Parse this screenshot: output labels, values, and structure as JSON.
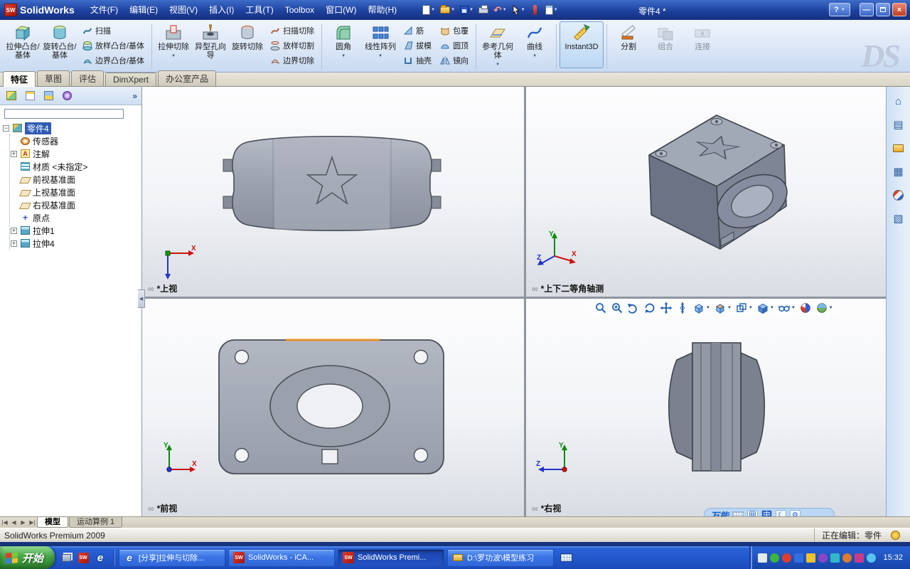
{
  "window": {
    "app_name": "SolidWorks",
    "doc_title": "零件4 *",
    "help_label": "?"
  },
  "menubar": {
    "items": [
      {
        "label": "文件(F)"
      },
      {
        "label": "编辑(E)"
      },
      {
        "label": "视图(V)"
      },
      {
        "label": "插入(I)"
      },
      {
        "label": "工具(T)"
      },
      {
        "label": "Toolbox"
      },
      {
        "label": "窗口(W)"
      },
      {
        "label": "帮助(H)"
      }
    ]
  },
  "ribbon": {
    "watermark": "DS",
    "buttons": {
      "extrude_boss": "拉伸凸台/基体",
      "revolve_boss": "旋转凸台/基体",
      "sweep": "扫描",
      "loft_boss": "放样凸台/基体",
      "boundary_boss": "边界凸台/基体",
      "extrude_cut": "拉伸切除",
      "hole_wizard": "异型孔向导",
      "revolve_cut": "旋转切除",
      "sweep_cut": "扫描切除",
      "loft_cut": "放样切割",
      "boundary_cut": "边界切除",
      "fillet": "圆角",
      "linear_pattern": "线性阵列",
      "rib": "筋",
      "draft": "拔模",
      "shell": "抽壳",
      "wrap": "包覆",
      "dome": "圆顶",
      "mirror": "镜向",
      "reference_geometry": "参考几何体",
      "curves": "曲线",
      "instant3d": "Instant3D",
      "split": "分割",
      "combine": "组合",
      "join": "连接"
    }
  },
  "command_tabs": {
    "items": [
      {
        "label": "特征"
      },
      {
        "label": "草图"
      },
      {
        "label": "评估"
      },
      {
        "label": "DimXpert"
      },
      {
        "label": "办公室产品"
      }
    ]
  },
  "feature_panel": {
    "tree": {
      "root": "零件4",
      "items": [
        {
          "label": "传感器"
        },
        {
          "label": "注解"
        },
        {
          "label": "材质 <未指定>"
        },
        {
          "label": "前视基准面"
        },
        {
          "label": "上视基准面"
        },
        {
          "label": "右视基准面"
        },
        {
          "label": "原点"
        },
        {
          "label": "拉伸1"
        },
        {
          "label": "拉伸4"
        }
      ]
    }
  },
  "viewports": {
    "top_left": {
      "label": "*上视"
    },
    "top_right": {
      "label": "*上下二等角轴测"
    },
    "bottom_left": {
      "label": "*前视"
    },
    "bottom_right": {
      "label": "*右视"
    },
    "axis": {
      "x": "X",
      "y": "Y",
      "z": "Z"
    }
  },
  "ime_bar": {
    "name": "万能",
    "web": "网",
    "lang": "中"
  },
  "doc_tabs": {
    "items": [
      {
        "label": "模型"
      },
      {
        "label": "运动算例 1"
      }
    ]
  },
  "statusbar": {
    "left": "SolidWorks Premium 2009",
    "editing": "正在编辑：零件"
  },
  "taskbar": {
    "start_label": "开始",
    "tasks": [
      {
        "label": "[分享]拉伸与切除..."
      },
      {
        "label": "SolidWorks - iCA..."
      },
      {
        "label": "SolidWorks Premi..."
      },
      {
        "label": "D:\\罗功波\\模型练习"
      }
    ],
    "clock": "15:32"
  },
  "icons": {
    "ie_glyph": "e",
    "sw_glyph": "SW",
    "annotation_glyph": "A",
    "origin_glyph": "+"
  }
}
